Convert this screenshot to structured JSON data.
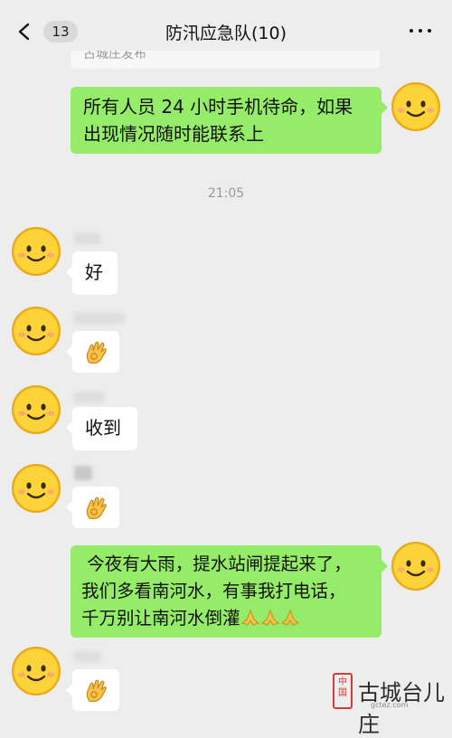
{
  "header": {
    "unread_count": "13",
    "title": "防汛应急队(10)"
  },
  "partial_message": "古城庄发布",
  "messages": [
    {
      "side": "right",
      "text": "所有人员 24 小时手机待命，如果出现情况随时能联系上"
    },
    {
      "side": "left",
      "text": "好"
    },
    {
      "side": "left",
      "emoji": "ok-hand"
    },
    {
      "side": "left",
      "text": "收到"
    },
    {
      "side": "left",
      "emoji": "ok-hand"
    },
    {
      "side": "right",
      "text_line1": " 今夜有大雨，提水站闸提起来了，",
      "text_line2": "我们多看南河水，有事我打电话，",
      "text_line3": "千万别让南河水倒灌",
      "trailing_emoji": "folded-hands x3"
    },
    {
      "side": "left",
      "emoji": "ok-hand"
    }
  ],
  "timestamp": "21:05",
  "watermark": {
    "seal_text": "中国",
    "text": "古城台儿庄",
    "url": "gctez.com"
  },
  "colors": {
    "background": "#ededed",
    "outgoing_bubble": "#95ec69",
    "incoming_bubble": "#ffffff",
    "timestamp": "#999999"
  }
}
